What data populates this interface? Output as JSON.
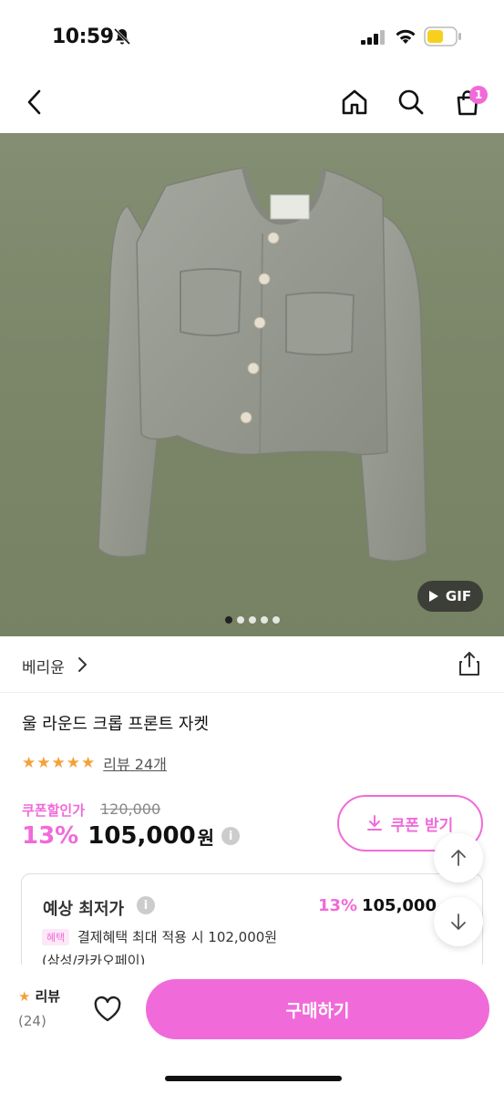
{
  "status_bar": {
    "time": "10:59"
  },
  "nav": {
    "cart_count": "1"
  },
  "hero": {
    "gif_label": "GIF",
    "dot_count": 5,
    "active_dot": 0
  },
  "brand": {
    "name": "베리윤"
  },
  "product": {
    "title": "울 라운드 크롭 프론트 자켓",
    "rating_stars": 5,
    "review_link": "리뷰 24개",
    "coupon_label": "쿠폰할인가",
    "original_price": "120,000",
    "discount": "13%",
    "price": "105,000",
    "currency": "원",
    "info_symbol": "i"
  },
  "coupon_button": {
    "label": "쿠폰 받기"
  },
  "estimate": {
    "title": "예상 최저가",
    "discount": "13%",
    "price": "105,000",
    "benefit_tag": "혜택",
    "benefit_text": "결제혜택 최대 적용 시 102,000원",
    "benefit_sub": "(삼성/카카오페이)"
  },
  "bottom_bar": {
    "review_label": "리뷰",
    "review_count": "(24)",
    "buy_label": "구매하기"
  },
  "colors": {
    "accent": "#f06bd9",
    "star": "#f5a13a"
  }
}
